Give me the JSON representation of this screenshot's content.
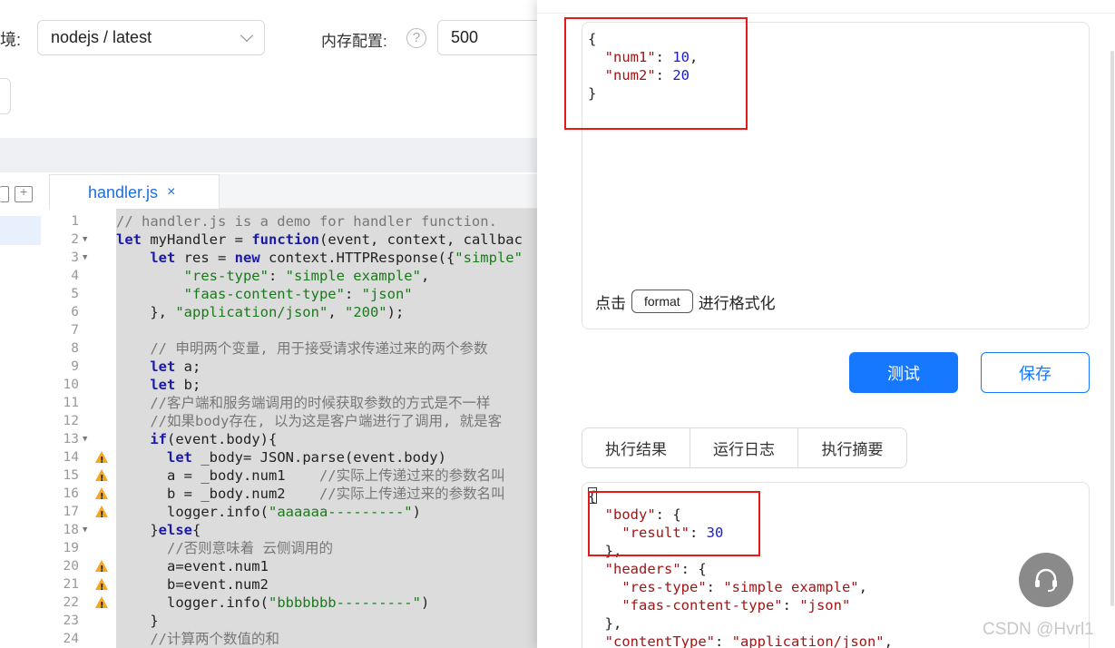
{
  "config": {
    "env_label": "境:",
    "runtime_value": "nodejs / latest",
    "memory_label": "内存配置:",
    "help_glyph": "?",
    "memory_value": "500"
  },
  "editor": {
    "tab_name": "handler.js",
    "tab_close": "×",
    "lines": [
      {
        "n": "1",
        "text": "// handler.js is a demo for handler function.",
        "fold": false,
        "warn": false
      },
      {
        "n": "2",
        "text": "let myHandler = function(event, context, callbac",
        "fold": true,
        "warn": false
      },
      {
        "n": "3",
        "text": "    let res = new context.HTTPResponse({\"simple\"",
        "fold": true,
        "warn": false
      },
      {
        "n": "4",
        "text": "        \"res-type\": \"simple example\",",
        "fold": false,
        "warn": false
      },
      {
        "n": "5",
        "text": "        \"faas-content-type\": \"json\"",
        "fold": false,
        "warn": false
      },
      {
        "n": "6",
        "text": "    }, \"application/json\", \"200\");",
        "fold": false,
        "warn": false
      },
      {
        "n": "7",
        "text": "",
        "fold": false,
        "warn": false
      },
      {
        "n": "8",
        "text": "    // 申明两个变量, 用于接受请求传递过来的两个参数",
        "fold": false,
        "warn": false
      },
      {
        "n": "9",
        "text": "    let a;",
        "fold": false,
        "warn": false
      },
      {
        "n": "10",
        "text": "    let b;",
        "fold": false,
        "warn": false
      },
      {
        "n": "11",
        "text": "    //客户端和服务端调用的时候获取参数的方式是不一样",
        "fold": false,
        "warn": false
      },
      {
        "n": "12",
        "text": "    //如果body存在, 以为这是客户端进行了调用, 就是客",
        "fold": false,
        "warn": false
      },
      {
        "n": "13",
        "text": "    if(event.body){",
        "fold": true,
        "warn": false
      },
      {
        "n": "14",
        "text": "      let _body= JSON.parse(event.body)",
        "fold": false,
        "warn": true
      },
      {
        "n": "15",
        "text": "      a = _body.num1    //实际上传递过来的参数名叫",
        "fold": false,
        "warn": true
      },
      {
        "n": "16",
        "text": "      b = _body.num2    //实际上传递过来的参数名叫",
        "fold": false,
        "warn": true
      },
      {
        "n": "17",
        "text": "      logger.info(\"aaaaaa---------\")",
        "fold": false,
        "warn": true
      },
      {
        "n": "18",
        "text": "    }else{",
        "fold": true,
        "warn": false
      },
      {
        "n": "19",
        "text": "      //否则意味着 云侧调用的",
        "fold": false,
        "warn": false
      },
      {
        "n": "20",
        "text": "      a=event.num1",
        "fold": false,
        "warn": true
      },
      {
        "n": "21",
        "text": "      b=event.num2",
        "fold": false,
        "warn": true
      },
      {
        "n": "22",
        "text": "      logger.info(\"bbbbbbb---------\")",
        "fold": false,
        "warn": true
      },
      {
        "n": "23",
        "text": "    }",
        "fold": false,
        "warn": false
      },
      {
        "n": "24",
        "text": "    //计算两个数值的和",
        "fold": false,
        "warn": false
      }
    ]
  },
  "request": {
    "json_lines": [
      "{",
      "  \"num1\": 10,",
      "  \"num2\": 20",
      "}"
    ],
    "format_prefix": "点击",
    "format_button": "format",
    "format_suffix": "进行格式化"
  },
  "actions": {
    "test_label": "测试",
    "save_label": "保存"
  },
  "result_tabs": [
    "执行结果",
    "运行日志",
    "执行摘要"
  ],
  "result": {
    "json_lines": [
      "{",
      "  \"body\": {",
      "    \"result\": 30",
      "  },",
      "  \"headers\": {",
      "    \"res-type\": \"simple example\",",
      "    \"faas-content-type\": \"json\"",
      "  },",
      "  \"contentType\": \"application/json\","
    ]
  },
  "support_icon": "headset-icon",
  "watermark": "CSDN @Hvrl1",
  "colors": {
    "primary": "#1677ff",
    "highlight_box": "#e81818",
    "warning": "#f5a623"
  }
}
